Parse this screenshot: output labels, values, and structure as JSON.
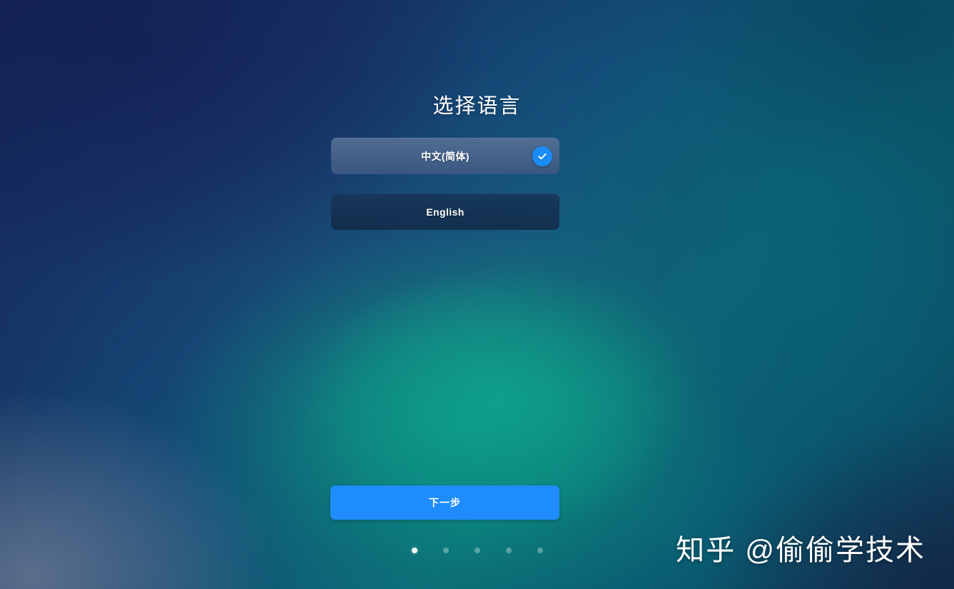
{
  "screen": {
    "title": "选择语言",
    "background_colors": {
      "top_left_navy": "#16275c",
      "mid_left_blue": "#12507a",
      "center_green": "#0a8a80",
      "right_teal": "#0a5f75",
      "top_right": "#0a4a68",
      "bottom_left_slate": "#5a6d8a",
      "bottom_right_dark": "#162a4e"
    }
  },
  "language_list": {
    "options": [
      {
        "label": "中文(简体)",
        "selected": true,
        "check_icon": "check-circle-icon",
        "background": "#3d5a80",
        "check_color": "#1a8cf5"
      },
      {
        "label": "English",
        "selected": false,
        "background": "#16304f"
      }
    ]
  },
  "footer": {
    "next_button_label": "下一步",
    "next_button_color": "#1e8cfb",
    "pager": {
      "total": 5,
      "active_index": 0,
      "active_color": "#ffffff",
      "inactive_color": "rgba(255,255,255,0.32)"
    }
  },
  "watermark": {
    "text": "知乎 @偷偷学技术"
  }
}
